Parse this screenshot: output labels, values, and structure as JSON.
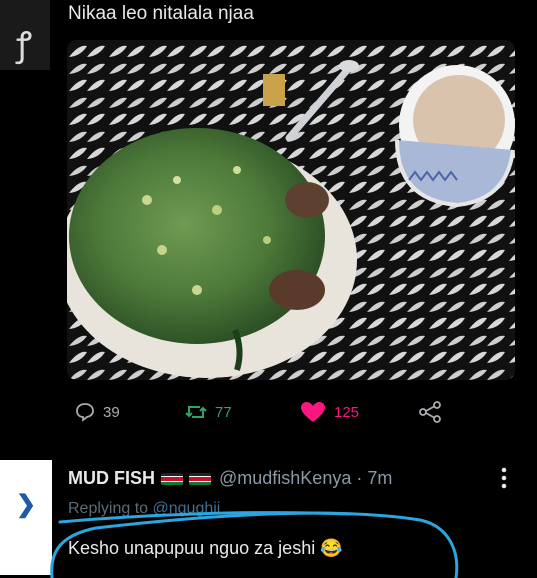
{
  "tweet": {
    "text": "Nikaa leo nitalala njaa",
    "reply_count": "39",
    "retweet_count": "77",
    "like_count": "125"
  },
  "reply": {
    "display_name": "MUD FISH",
    "handle_time": "@mudfishKenya · 7m",
    "replying_prefix": "Replying to ",
    "replying_user": "@ngughii",
    "text": "Kesho unapupuu nguo za jeshi 😂"
  },
  "colors": {
    "retweet": "#2ea46a",
    "like": "#f91880",
    "muted": "#8b98a5",
    "annotation": "#2aa6e0"
  },
  "icons": [
    "reply-icon",
    "retweet-icon",
    "heart-icon",
    "share-icon",
    "more-icon",
    "kenya-flag-icon"
  ]
}
